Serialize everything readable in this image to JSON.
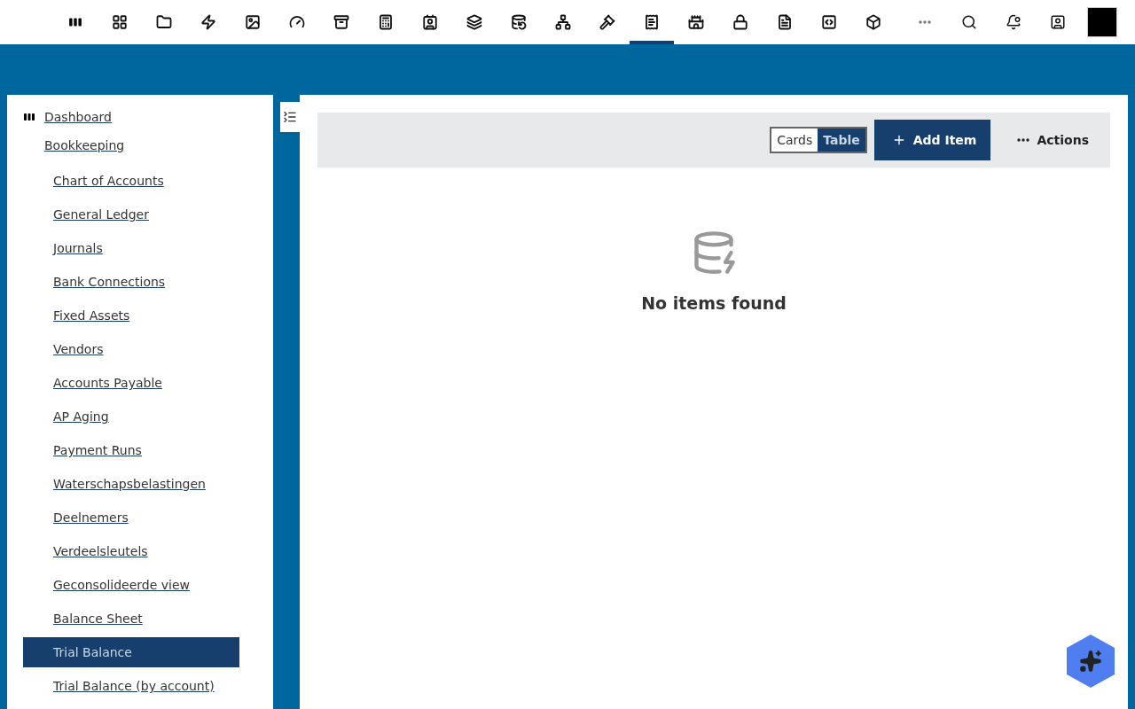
{
  "top_nav": {
    "apps": [
      {
        "selected": false
      },
      {
        "selected": false
      },
      {
        "selected": false
      },
      {
        "selected": false
      },
      {
        "selected": false
      },
      {
        "selected": false
      },
      {
        "selected": false
      },
      {
        "selected": false
      },
      {
        "selected": false
      },
      {
        "selected": false
      },
      {
        "selected": false
      },
      {
        "selected": false
      },
      {
        "selected": false
      },
      {
        "selected": true
      },
      {
        "selected": false
      },
      {
        "selected": false
      },
      {
        "selected": false
      },
      {
        "selected": false
      },
      {
        "selected": false
      }
    ]
  },
  "sidebar": {
    "home": {
      "label": "Dashboard"
    },
    "group": {
      "label": "Bookkeeping",
      "items": [
        {
          "label": "Chart of Accounts",
          "selected": false
        },
        {
          "label": "General Ledger",
          "selected": false
        },
        {
          "label": "Journals",
          "selected": false
        },
        {
          "label": "Bank Connections",
          "selected": false
        },
        {
          "label": "Fixed Assets",
          "selected": false
        },
        {
          "label": "Vendors",
          "selected": false
        },
        {
          "label": "Accounts Payable",
          "selected": false
        },
        {
          "label": "AP Aging",
          "selected": false
        },
        {
          "label": "Payment Runs",
          "selected": false
        },
        {
          "label": "Waterschapsbelastingen",
          "selected": false
        },
        {
          "label": "Deelnemers",
          "selected": false
        },
        {
          "label": "Verdeelsleutels",
          "selected": false
        },
        {
          "label": "Geconsolideerde view",
          "selected": false
        },
        {
          "label": "Balance Sheet",
          "selected": false
        },
        {
          "label": "Trial Balance",
          "selected": true
        },
        {
          "label": "Trial Balance (by account)",
          "selected": false
        }
      ]
    }
  },
  "toolbar": {
    "view_toggle": [
      {
        "label": "Cards",
        "selected": false
      },
      {
        "label": "Table",
        "selected": true
      }
    ],
    "add_button": "Add Item",
    "actions_button": "Actions"
  },
  "empty_state": {
    "message": "No items found"
  }
}
